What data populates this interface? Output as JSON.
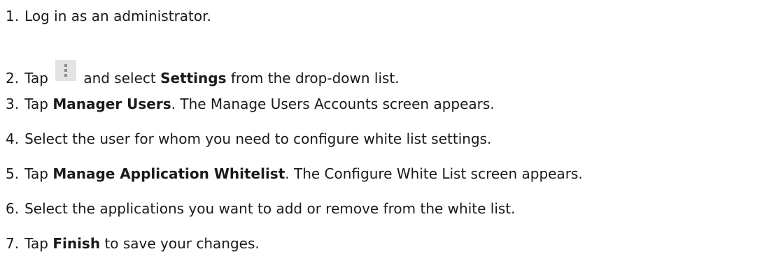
{
  "steps": [
    {
      "number": "1.",
      "text": "Log in as an administrator."
    },
    {
      "number": "2.",
      "pre": "Tap",
      "icon": "overflow-menu-icon",
      "mid": "and select",
      "bold": "Settings",
      "post": "from the drop-down list."
    },
    {
      "number": "3.",
      "pre": "Tap",
      "bold": "Manager Users",
      "post": ". The Manage Users Accounts screen appears."
    },
    {
      "number": "4.",
      "text": "Select the user for whom you need to configure white list settings."
    },
    {
      "number": "5.",
      "pre": "Tap",
      "bold": "Manage Application Whitelist",
      "post": ". The Configure White List screen appears."
    },
    {
      "number": "6.",
      "text": "Select the applications you want to add or remove from the white list."
    },
    {
      "number": "7.",
      "pre": "Tap",
      "bold": "Finish",
      "post": "to save your changes."
    }
  ],
  "colors": {
    "text": "#1a1a1a",
    "icon_background": "#e3e3e3",
    "icon_dots": "#8c8c8c"
  }
}
